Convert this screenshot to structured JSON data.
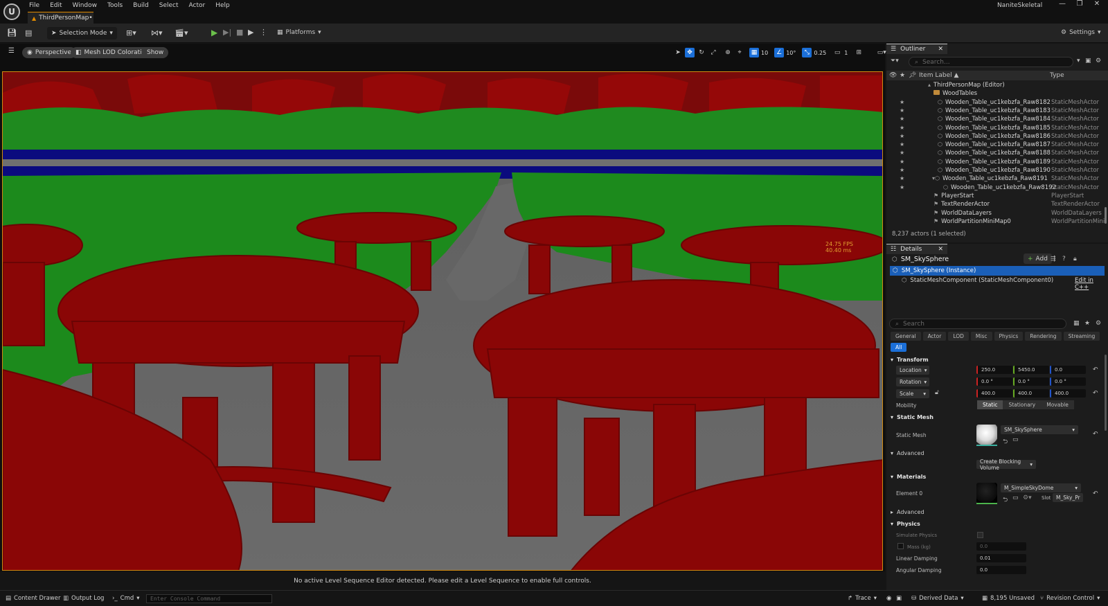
{
  "app": {
    "logo": "U",
    "menu": [
      "File",
      "Edit",
      "Window",
      "Tools",
      "Build",
      "Select",
      "Actor",
      "Help"
    ],
    "document_tab": "ThirdPersonMap•",
    "project_name": "NaniteSkeletal",
    "window_controls": [
      "—",
      "❐",
      "✕"
    ]
  },
  "toolbar": {
    "selection_mode": "Selection Mode",
    "platforms": "Platforms",
    "settings": "Settings"
  },
  "viewport": {
    "perspective": "Perspective",
    "view_mode": "Mesh LOD Coloration",
    "show": "Show",
    "grid_snap": "10",
    "rotation_snap": "10°",
    "scale_snap": "0.25",
    "camera_speed": "1",
    "fps": "24.75 FPS",
    "frame_ms": "40.40 ms",
    "lod_colors": {
      "lod0": "#8a0606",
      "lod1": "#1c8a1c",
      "lod2": "#0a0a80",
      "floor": "#656565"
    }
  },
  "sequencer_message": "No active Level Sequence Editor detected. Please edit a Level Sequence to enable full controls.",
  "outliner": {
    "tab": "Outliner",
    "search_placeholder": "Search...",
    "col_label": "Item Label ▲",
    "col_type": "Type",
    "rows": [
      {
        "label": "ThirdPersonMap (Editor)",
        "type": "",
        "indent": 60,
        "star": false,
        "kind": "map"
      },
      {
        "label": "WoodTables",
        "type": "",
        "indent": 68,
        "star": false,
        "kind": "folder"
      },
      {
        "label": "Wooden_Table_uc1kebzfa_Raw8182",
        "type": "StaticMeshActor",
        "indent": 74,
        "star": true,
        "kind": "mesh"
      },
      {
        "label": "Wooden_Table_uc1kebzfa_Raw8183",
        "type": "StaticMeshActor",
        "indent": 74,
        "star": true,
        "kind": "mesh"
      },
      {
        "label": "Wooden_Table_uc1kebzfa_Raw8184",
        "type": "StaticMeshActor",
        "indent": 74,
        "star": true,
        "kind": "mesh"
      },
      {
        "label": "Wooden_Table_uc1kebzfa_Raw8185",
        "type": "StaticMeshActor",
        "indent": 74,
        "star": true,
        "kind": "mesh"
      },
      {
        "label": "Wooden_Table_uc1kebzfa_Raw8186",
        "type": "StaticMeshActor",
        "indent": 74,
        "star": true,
        "kind": "mesh"
      },
      {
        "label": "Wooden_Table_uc1kebzfa_Raw8187",
        "type": "StaticMeshActor",
        "indent": 74,
        "star": true,
        "kind": "mesh"
      },
      {
        "label": "Wooden_Table_uc1kebzfa_Raw8188",
        "type": "StaticMeshActor",
        "indent": 74,
        "star": true,
        "kind": "mesh"
      },
      {
        "label": "Wooden_Table_uc1kebzfa_Raw8189",
        "type": "StaticMeshActor",
        "indent": 74,
        "star": true,
        "kind": "mesh"
      },
      {
        "label": "Wooden_Table_uc1kebzfa_Raw8190",
        "type": "StaticMeshActor",
        "indent": 74,
        "star": true,
        "kind": "mesh"
      },
      {
        "label": "Wooden_Table_uc1kebzfa_Raw8191",
        "type": "StaticMeshActor",
        "indent": 66,
        "star": true,
        "kind": "mesh-expand"
      },
      {
        "label": "Wooden_Table_uc1kebzfa_Raw8192",
        "type": "StaticMeshActor",
        "indent": 82,
        "star": true,
        "kind": "mesh"
      },
      {
        "label": "PlayerStart",
        "type": "PlayerStart",
        "indent": 68,
        "star": false,
        "kind": "actor"
      },
      {
        "label": "TextRenderActor",
        "type": "TextRenderActor",
        "indent": 68,
        "star": false,
        "kind": "actor"
      },
      {
        "label": "WorldDataLayers",
        "type": "WorldDataLayers",
        "indent": 68,
        "star": false,
        "kind": "actor"
      },
      {
        "label": "WorldPartitionMiniMap0",
        "type": "WorldPartitionMini",
        "indent": 68,
        "star": false,
        "kind": "actor"
      }
    ],
    "actor_count": "8,237 actors (1 selected)"
  },
  "details": {
    "tab": "Details",
    "actor_name": "SM_SkySphere",
    "add_label": "Add",
    "instance_label": "SM_SkySphere (Instance)",
    "component_label": "StaticMeshComponent (StaticMeshComponent0)",
    "edit_cpp": "Edit in C++",
    "search_placeholder": "Search",
    "categories": [
      "General",
      "Actor",
      "LOD",
      "Misc",
      "Physics",
      "Rendering",
      "Streaming"
    ],
    "category_all": "All",
    "transform": {
      "title": "Transform",
      "location_label": "Location",
      "location": [
        "250.0",
        "5450.0",
        "0.0"
      ],
      "rotation_label": "Rotation",
      "rotation": [
        "0.0 °",
        "0.0 °",
        "0.0 °"
      ],
      "scale_label": "Scale",
      "scale": [
        "400.0",
        "400.0",
        "400.0"
      ],
      "mobility_label": "Mobility",
      "mobility": [
        "Static",
        "Stationary",
        "Movable"
      ]
    },
    "static_mesh": {
      "title": "Static Mesh",
      "label": "Static Mesh",
      "value": "SM_SkySphere",
      "advanced": "Advanced",
      "blocking_volume": "Create Blocking Volume"
    },
    "materials": {
      "title": "Materials",
      "element_label": "Element 0",
      "value": "M_SimpleSkyDome",
      "slot_label": "Slot",
      "slot_value": "M_Sky_Pr",
      "advanced": "Advanced"
    },
    "physics": {
      "title": "Physics",
      "simulate_label": "Simulate Physics",
      "mass_label": "Mass (kg)",
      "mass_value": "0.0",
      "linear_label": "Linear Damping",
      "linear_value": "0.01",
      "angular_label": "Angular Damping",
      "angular_value": "0.0"
    }
  },
  "statusbar": {
    "content_drawer": "Content Drawer",
    "output_log": "Output Log",
    "cmd": "Cmd",
    "console_placeholder": "Enter Console Command",
    "trace": "Trace",
    "derived_data": "Derived Data",
    "unsaved": "8,195 Unsaved",
    "revision_control": "Revision Control"
  }
}
